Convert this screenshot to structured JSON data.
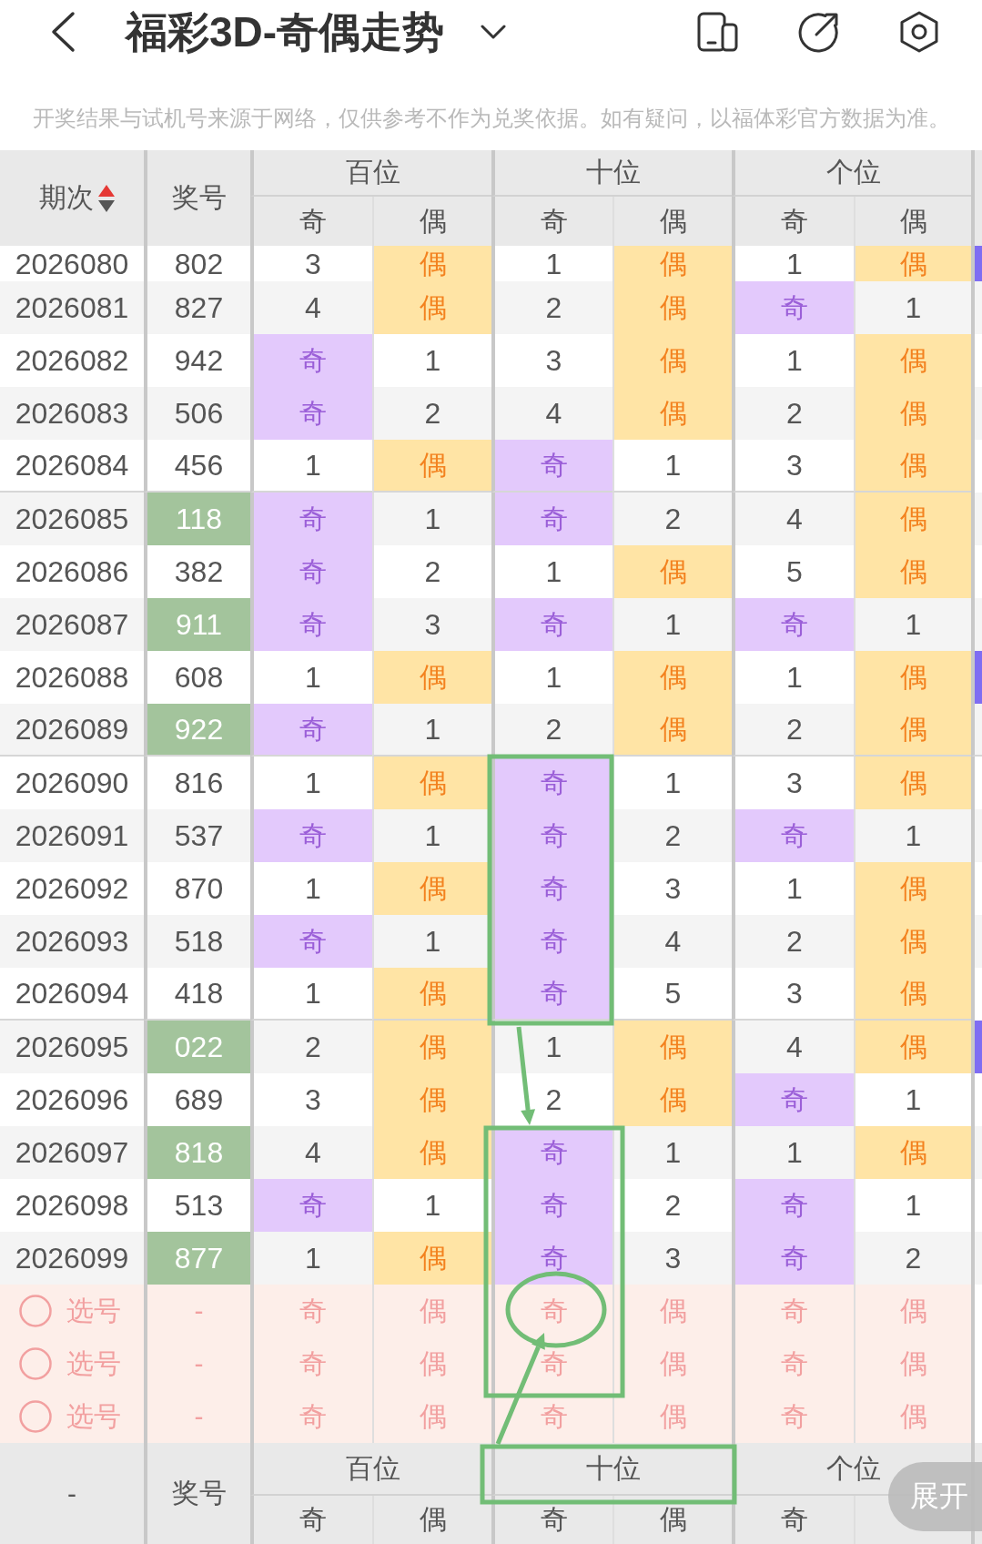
{
  "header": {
    "title": "福彩3D-奇偶走势"
  },
  "notice": "开奖结果与试机号来源于网络，仅供参考不作为兑奖依据。如有疑问，以福体彩官方数据为准。",
  "table": {
    "columns": {
      "period": "期次",
      "period_sort_ascending": true,
      "number": "奖号",
      "groups": [
        {
          "label": "百位",
          "odd": "奇",
          "even": "偶"
        },
        {
          "label": "十位",
          "odd": "奇",
          "even": "偶"
        },
        {
          "label": "个位",
          "odd": "奇",
          "even": "偶"
        }
      ]
    },
    "rows": [
      {
        "period": "2026080",
        "number": "802",
        "highlighted": false,
        "column_9_filled": true,
        "cells": [
          {
            "text": "3",
            "hit": false
          },
          {
            "text": "偶",
            "hit": true
          },
          {
            "text": "1",
            "hit": false
          },
          {
            "text": "偶",
            "hit": true
          },
          {
            "text": "1",
            "hit": false
          },
          {
            "text": "偶",
            "hit": true
          }
        ]
      },
      {
        "period": "2026081",
        "number": "827",
        "highlighted": false,
        "column_9_filled": false,
        "cells": [
          {
            "text": "4",
            "hit": false
          },
          {
            "text": "偶",
            "hit": true
          },
          {
            "text": "2",
            "hit": false
          },
          {
            "text": "偶",
            "hit": true
          },
          {
            "text": "奇",
            "hit": true
          },
          {
            "text": "1",
            "hit": false
          }
        ]
      },
      {
        "period": "2026082",
        "number": "942",
        "highlighted": false,
        "column_9_filled": false,
        "cells": [
          {
            "text": "奇",
            "hit": true
          },
          {
            "text": "1",
            "hit": false
          },
          {
            "text": "3",
            "hit": false
          },
          {
            "text": "偶",
            "hit": true
          },
          {
            "text": "1",
            "hit": false
          },
          {
            "text": "偶",
            "hit": true
          }
        ]
      },
      {
        "period": "2026083",
        "number": "506",
        "highlighted": false,
        "column_9_filled": false,
        "cells": [
          {
            "text": "奇",
            "hit": true
          },
          {
            "text": "2",
            "hit": false
          },
          {
            "text": "4",
            "hit": false
          },
          {
            "text": "偶",
            "hit": true
          },
          {
            "text": "2",
            "hit": false
          },
          {
            "text": "偶",
            "hit": true
          }
        ]
      },
      {
        "period": "2026084",
        "number": "456",
        "highlighted": false,
        "column_9_filled": false,
        "cells": [
          {
            "text": "1",
            "hit": false
          },
          {
            "text": "偶",
            "hit": true
          },
          {
            "text": "奇",
            "hit": true
          },
          {
            "text": "1",
            "hit": false
          },
          {
            "text": "3",
            "hit": false
          },
          {
            "text": "偶",
            "hit": true
          }
        ]
      },
      {
        "period": "2026085",
        "number": "118",
        "highlighted": true,
        "column_9_filled": false,
        "cells": [
          {
            "text": "奇",
            "hit": true
          },
          {
            "text": "1",
            "hit": false
          },
          {
            "text": "奇",
            "hit": true
          },
          {
            "text": "2",
            "hit": false
          },
          {
            "text": "4",
            "hit": false
          },
          {
            "text": "偶",
            "hit": true
          }
        ]
      },
      {
        "period": "2026086",
        "number": "382",
        "highlighted": false,
        "column_9_filled": false,
        "cells": [
          {
            "text": "奇",
            "hit": true
          },
          {
            "text": "2",
            "hit": false
          },
          {
            "text": "1",
            "hit": false
          },
          {
            "text": "偶",
            "hit": true
          },
          {
            "text": "5",
            "hit": false
          },
          {
            "text": "偶",
            "hit": true
          }
        ]
      },
      {
        "period": "2026087",
        "number": "911",
        "highlighted": true,
        "column_9_filled": false,
        "cells": [
          {
            "text": "奇",
            "hit": true
          },
          {
            "text": "3",
            "hit": false
          },
          {
            "text": "奇",
            "hit": true
          },
          {
            "text": "1",
            "hit": false
          },
          {
            "text": "奇",
            "hit": true
          },
          {
            "text": "1",
            "hit": false
          }
        ]
      },
      {
        "period": "2026088",
        "number": "608",
        "highlighted": false,
        "column_9_filled": true,
        "cells": [
          {
            "text": "1",
            "hit": false
          },
          {
            "text": "偶",
            "hit": true
          },
          {
            "text": "1",
            "hit": false
          },
          {
            "text": "偶",
            "hit": true
          },
          {
            "text": "1",
            "hit": false
          },
          {
            "text": "偶",
            "hit": true
          }
        ]
      },
      {
        "period": "2026089",
        "number": "922",
        "highlighted": true,
        "column_9_filled": false,
        "cells": [
          {
            "text": "奇",
            "hit": true
          },
          {
            "text": "1",
            "hit": false
          },
          {
            "text": "2",
            "hit": false
          },
          {
            "text": "偶",
            "hit": true
          },
          {
            "text": "2",
            "hit": false
          },
          {
            "text": "偶",
            "hit": true
          }
        ]
      },
      {
        "period": "2026090",
        "number": "816",
        "highlighted": false,
        "column_9_filled": false,
        "cells": [
          {
            "text": "1",
            "hit": false
          },
          {
            "text": "偶",
            "hit": true
          },
          {
            "text": "奇",
            "hit": true
          },
          {
            "text": "1",
            "hit": false
          },
          {
            "text": "3",
            "hit": false
          },
          {
            "text": "偶",
            "hit": true
          }
        ]
      },
      {
        "period": "2026091",
        "number": "537",
        "highlighted": false,
        "column_9_filled": false,
        "cells": [
          {
            "text": "奇",
            "hit": true
          },
          {
            "text": "1",
            "hit": false
          },
          {
            "text": "奇",
            "hit": true
          },
          {
            "text": "2",
            "hit": false
          },
          {
            "text": "奇",
            "hit": true
          },
          {
            "text": "1",
            "hit": false
          }
        ]
      },
      {
        "period": "2026092",
        "number": "870",
        "highlighted": false,
        "column_9_filled": false,
        "cells": [
          {
            "text": "1",
            "hit": false
          },
          {
            "text": "偶",
            "hit": true
          },
          {
            "text": "奇",
            "hit": true
          },
          {
            "text": "3",
            "hit": false
          },
          {
            "text": "1",
            "hit": false
          },
          {
            "text": "偶",
            "hit": true
          }
        ]
      },
      {
        "period": "2026093",
        "number": "518",
        "highlighted": false,
        "column_9_filled": false,
        "cells": [
          {
            "text": "奇",
            "hit": true
          },
          {
            "text": "1",
            "hit": false
          },
          {
            "text": "奇",
            "hit": true
          },
          {
            "text": "4",
            "hit": false
          },
          {
            "text": "2",
            "hit": false
          },
          {
            "text": "偶",
            "hit": true
          }
        ]
      },
      {
        "period": "2026094",
        "number": "418",
        "highlighted": false,
        "column_9_filled": false,
        "cells": [
          {
            "text": "1",
            "hit": false
          },
          {
            "text": "偶",
            "hit": true
          },
          {
            "text": "奇",
            "hit": true
          },
          {
            "text": "5",
            "hit": false
          },
          {
            "text": "3",
            "hit": false
          },
          {
            "text": "偶",
            "hit": true
          }
        ]
      },
      {
        "period": "2026095",
        "number": "022",
        "highlighted": true,
        "column_9_filled": true,
        "cells": [
          {
            "text": "2",
            "hit": false
          },
          {
            "text": "偶",
            "hit": true
          },
          {
            "text": "1",
            "hit": false
          },
          {
            "text": "偶",
            "hit": true
          },
          {
            "text": "4",
            "hit": false
          },
          {
            "text": "偶",
            "hit": true
          }
        ]
      },
      {
        "period": "2026096",
        "number": "689",
        "highlighted": false,
        "column_9_filled": false,
        "cells": [
          {
            "text": "3",
            "hit": false
          },
          {
            "text": "偶",
            "hit": true
          },
          {
            "text": "2",
            "hit": false
          },
          {
            "text": "偶",
            "hit": true
          },
          {
            "text": "奇",
            "hit": true
          },
          {
            "text": "1",
            "hit": false
          }
        ]
      },
      {
        "period": "2026097",
        "number": "818",
        "highlighted": true,
        "column_9_filled": false,
        "cells": [
          {
            "text": "4",
            "hit": false
          },
          {
            "text": "偶",
            "hit": true
          },
          {
            "text": "奇",
            "hit": true
          },
          {
            "text": "1",
            "hit": false
          },
          {
            "text": "1",
            "hit": false
          },
          {
            "text": "偶",
            "hit": true
          }
        ]
      },
      {
        "period": "2026098",
        "number": "513",
        "highlighted": false,
        "column_9_filled": false,
        "cells": [
          {
            "text": "奇",
            "hit": true
          },
          {
            "text": "1",
            "hit": false
          },
          {
            "text": "奇",
            "hit": true
          },
          {
            "text": "2",
            "hit": false
          },
          {
            "text": "奇",
            "hit": true
          },
          {
            "text": "1",
            "hit": false
          }
        ]
      },
      {
        "period": "2026099",
        "number": "877",
        "highlighted": true,
        "column_9_filled": false,
        "cells": [
          {
            "text": "1",
            "hit": false
          },
          {
            "text": "偶",
            "hit": true
          },
          {
            "text": "奇",
            "hit": true
          },
          {
            "text": "3",
            "hit": false
          },
          {
            "text": "奇",
            "hit": true
          },
          {
            "text": "2",
            "hit": false
          }
        ]
      }
    ],
    "pick_rows": [
      {
        "checked": false,
        "label": "选号",
        "number": "-",
        "options": [
          {
            "text": "奇",
            "selected": false
          },
          {
            "text": "偶",
            "selected": false
          },
          {
            "text": "奇",
            "selected": false
          },
          {
            "text": "偶",
            "selected": false
          },
          {
            "text": "奇",
            "selected": false
          },
          {
            "text": "偶",
            "selected": false
          }
        ]
      },
      {
        "checked": false,
        "label": "选号",
        "number": "-",
        "options": [
          {
            "text": "奇",
            "selected": false
          },
          {
            "text": "偶",
            "selected": false
          },
          {
            "text": "奇",
            "selected": false
          },
          {
            "text": "偶",
            "selected": false
          },
          {
            "text": "奇",
            "selected": false
          },
          {
            "text": "偶",
            "selected": false
          }
        ]
      },
      {
        "checked": false,
        "label": "选号",
        "number": "-",
        "options": [
          {
            "text": "奇",
            "selected": false
          },
          {
            "text": "偶",
            "selected": false
          },
          {
            "text": "奇",
            "selected": false
          },
          {
            "text": "偶",
            "selected": false
          },
          {
            "text": "奇",
            "selected": false
          },
          {
            "text": "偶",
            "selected": false
          }
        ]
      }
    ],
    "footer": {
      "period": "-",
      "number": "奖号",
      "groups": [
        {
          "label": "百位",
          "odd": "奇",
          "even": "偶"
        },
        {
          "label": "十位",
          "odd": "奇",
          "even": "偶"
        },
        {
          "label": "个位",
          "odd": "奇"
        }
      ]
    }
  },
  "expand_button": "展开",
  "annotations": [
    {
      "kind": "frame"
    },
    {
      "kind": "arrow"
    },
    {
      "kind": "frame"
    },
    {
      "kind": "ellipse"
    },
    {
      "kind": "arrow"
    },
    {
      "kind": "frame"
    }
  ]
}
